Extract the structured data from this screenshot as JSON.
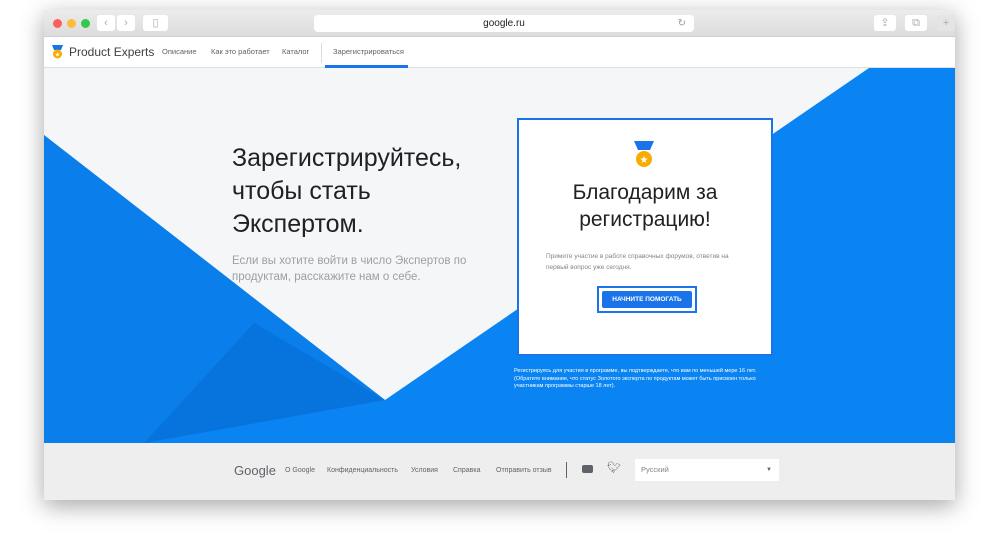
{
  "browser": {
    "url": "google.ru"
  },
  "nav": {
    "brand": "Product Experts",
    "items": [
      "Описание",
      "Как это работает",
      "Каталог"
    ],
    "register": "Зарегистрироваться"
  },
  "hero": {
    "title_lines": [
      "Зарегистрируйтесь,",
      "чтобы стать",
      "Экспертом."
    ],
    "subtitle": "Если вы хотите войти в число Экспертов по продуктам, расскажите нам о себе."
  },
  "card": {
    "title_lines": [
      "Благодарим за",
      "регистрацию!"
    ],
    "text": "Примите участие в работе справочных форумов, ответив на первый вопрос уже сегодня.",
    "button": "НАЧНИТЕ ПОМОГАТЬ"
  },
  "disclaimer": "Регистрируясь для участия в программе, вы подтверждаете, что вам по меньшей мере 16 лет. (Обратите внимание, что статус Золотого эксперта по продуктам может быть присвоен только участникам программы старше 18 лет).",
  "footer": {
    "logo": "Google",
    "links": [
      "О Google",
      "Конфиденциальность",
      "Условия",
      "Справка",
      "Отправить отзыв"
    ],
    "language": "Русский"
  },
  "colors": {
    "accent": "#1a73e8",
    "hero_blue": "#0a84f2"
  }
}
